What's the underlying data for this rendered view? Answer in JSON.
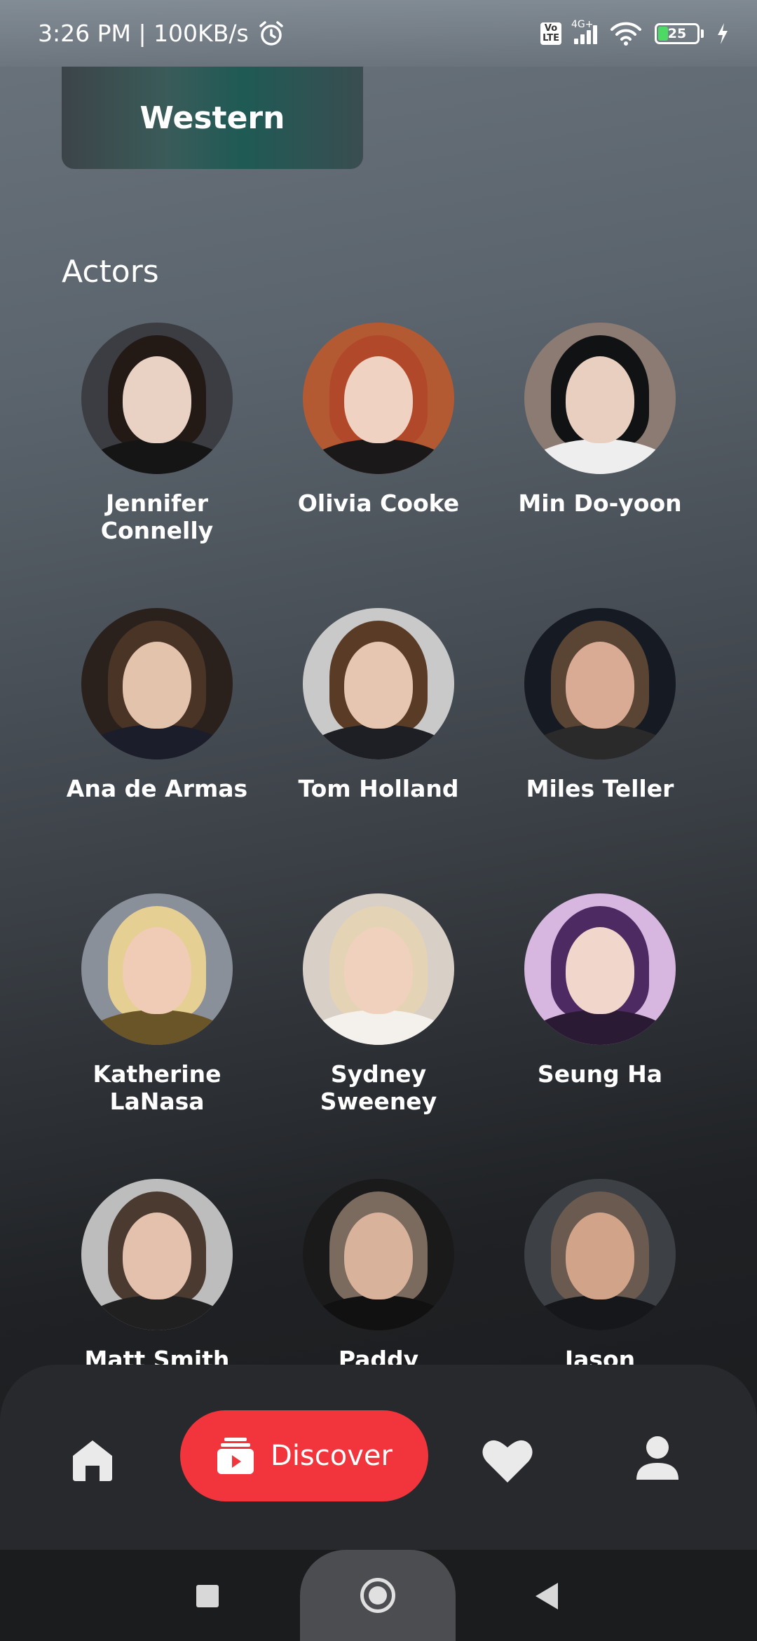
{
  "status_bar": {
    "time_speed": "3:26 PM | 100KB/s",
    "volte_line1": "Vo",
    "volte_line2": "LTE",
    "network": "4G+",
    "battery": "25"
  },
  "genre_card": {
    "label": "Western"
  },
  "actors_section": {
    "title": "Actors",
    "items": [
      {
        "name": "Jennifer Connelly",
        "bg": "#3b3d42",
        "hair": "#231a16",
        "skin": "#e9d2c4",
        "top": "#151515"
      },
      {
        "name": "Olivia Cooke",
        "bg": "#b35a33",
        "hair": "#b2482a",
        "skin": "#efd2c2",
        "top": "#1a1818"
      },
      {
        "name": "Min Do-yoon",
        "bg": "#8c7b72",
        "hair": "#111214",
        "skin": "#e8cfc0",
        "top": "#eeeeee"
      },
      {
        "name": "Ana de Armas",
        "bg": "#2a211d",
        "hair": "#4a3426",
        "skin": "#e4c3ad",
        "top": "#1b1e2a"
      },
      {
        "name": "Tom Holland",
        "bg": "#c9c9c9",
        "hair": "#5a3b26",
        "skin": "#e7c6b1",
        "top": "#1d1f24"
      },
      {
        "name": "Miles Teller",
        "bg": "#161a22",
        "hair": "#5a4535",
        "skin": "#d9ab94",
        "top": "#2a2a2a"
      },
      {
        "name": "Katherine LaNasa",
        "bg": "#8a9099",
        "hair": "#e6cf93",
        "skin": "#f0ccb6",
        "top": "#6a5528"
      },
      {
        "name": "Sydney Sweeney",
        "bg": "#d8cfc6",
        "hair": "#e5d3b5",
        "skin": "#f0d1bd",
        "top": "#f4f1ec"
      },
      {
        "name": "Seung Ha",
        "bg": "#d7b6e0",
        "hair": "#4e2a63",
        "skin": "#f1d6cc",
        "top": "#2a1a33"
      },
      {
        "name": "Matt Smith",
        "bg": "#bdbdbd",
        "hair": "#4a3a30",
        "skin": "#e3c1ad",
        "top": "#202020"
      },
      {
        "name": "Paddy",
        "bg": "#1a1a1a",
        "hair": "#7b6a5e",
        "skin": "#d9b29c",
        "top": "#111111"
      },
      {
        "name": "Jason",
        "bg": "#3d4045",
        "hair": "#6b5a4f",
        "skin": "#d1a48a",
        "top": "#15171a"
      }
    ]
  },
  "bottom_nav": {
    "home_icon": "home-icon",
    "discover_label": "Discover",
    "discover_icon": "discover-icon",
    "favorites_icon": "heart-icon",
    "profile_icon": "profile-icon",
    "accent": "#f2353c"
  },
  "system_nav": {
    "recents_icon": "recents-icon",
    "home_icon": "system-home-icon",
    "back_icon": "back-icon"
  }
}
